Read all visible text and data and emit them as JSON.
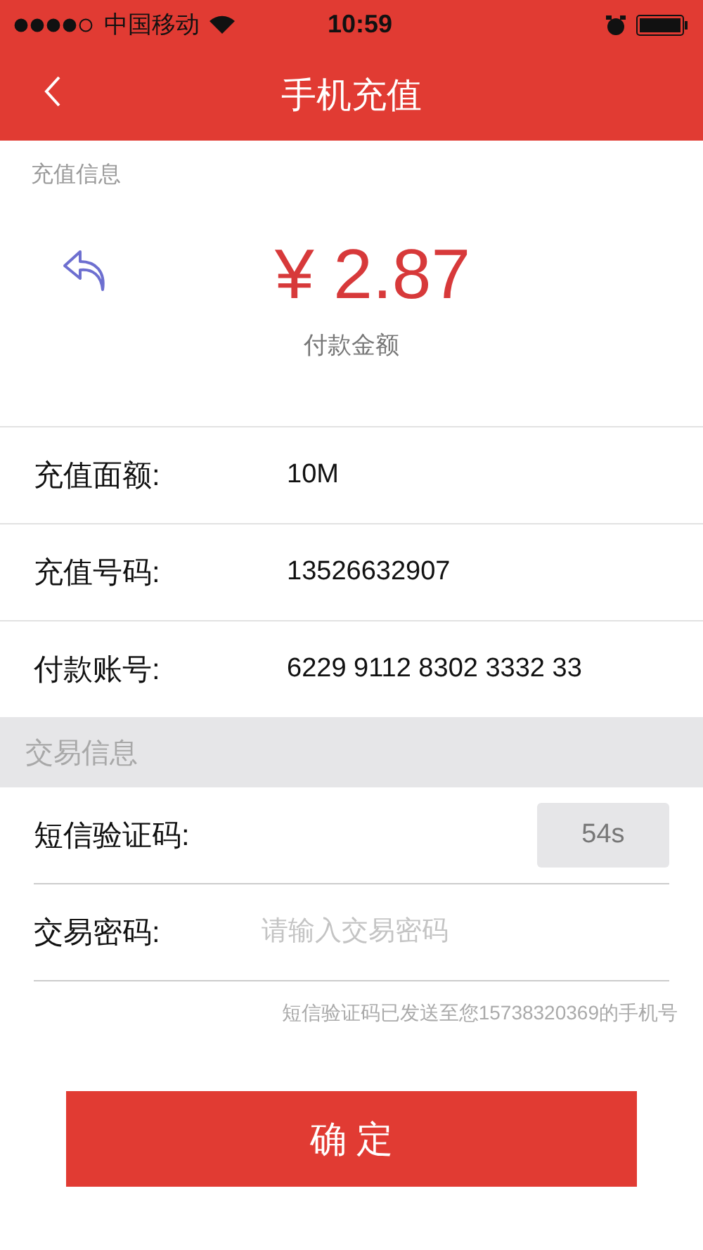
{
  "status_bar": {
    "carrier": "中国移动",
    "time": "10:59"
  },
  "nav": {
    "title": "手机充值"
  },
  "recharge_section": {
    "title": "充值信息",
    "amount": "¥ 2.87",
    "amount_label": "付款金额"
  },
  "details": [
    {
      "label": "充值面额:",
      "value": "10M"
    },
    {
      "label": "充值号码:",
      "value": "13526632907"
    },
    {
      "label": "付款账号:",
      "value": "6229 9112 8302 3332 33"
    }
  ],
  "transaction_section": {
    "title": "交易信息"
  },
  "sms_code": {
    "label": "短信验证码:",
    "countdown": "54s",
    "disabled": true
  },
  "password": {
    "label": "交易密码:",
    "placeholder": "请输入交易密码"
  },
  "notice": "短信验证码已发送至您15738320369的手机号",
  "confirm_button": "确 定"
}
